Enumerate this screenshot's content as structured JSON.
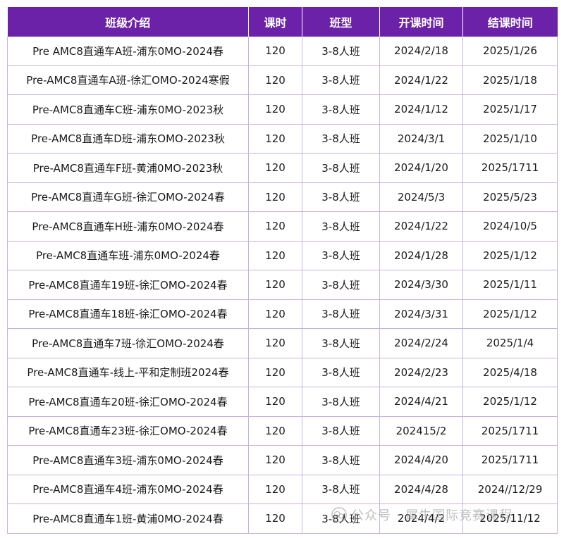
{
  "table": {
    "headers": [
      "班级介绍",
      "课时",
      "班型",
      "开课时间",
      "结课时间"
    ],
    "rows": [
      [
        "Pre AMC8直通车A班-浦东0MO-2024春",
        "120",
        "3-8人班",
        "2024/2/18",
        "2025/1/26"
      ],
      [
        "Pre-AMC8直通车A班-徐汇OMO-2024寒假",
        "120",
        "3-8人班",
        "2024/1/22",
        "2025/1/18"
      ],
      [
        "Pre-AMC8直通车C班-浦东0MO-2023秋",
        "120",
        "3-8人班",
        "2024/1/12",
        "2025/1/17"
      ],
      [
        "Pre-AMC8直通车D班-浦东OMO-2023秋",
        "120",
        "3-8人班",
        "2024/3/1",
        "2025/1/10"
      ],
      [
        "Pre-AMC8直通车F班-黄浦0MO-2023秋",
        "120",
        "3-8人班",
        "2024/1/20",
        "2025/1711"
      ],
      [
        "Pre-AMC8直通车G班-徐汇OMO-2024春",
        "120",
        "3-8人班",
        "2024/5/3",
        "2025/5/23"
      ],
      [
        "Pre-AMC8直通车H班-浦东0MO-2024春",
        "120",
        "3-8人班",
        "2024/1/22",
        "2024/10/5"
      ],
      [
        "Pre-AMC8直通车班-浦东0MO-2024春",
        "120",
        "3-8人班",
        "2024/1/28",
        "2025/1/12"
      ],
      [
        "Pre-AMC8直通车19班-徐汇OMO-2024春",
        "120",
        "3-8人班",
        "2024/3/30",
        "2025/1/11"
      ],
      [
        "Pre-AMC8直通车18班-徐汇OMO-2024春",
        "120",
        "3-8人班",
        "2024/3/31",
        "2025/1/12"
      ],
      [
        "Pre-AMC8直通车7班-徐汇OMO-2024春",
        "120",
        "3-8人班",
        "2024/2/24",
        "2025/1/4"
      ],
      [
        "Pre-AMC8直通车-线上-平和定制班2024春",
        "120",
        "3-8人班",
        "2024/2/23",
        "2025/4/18"
      ],
      [
        "Pre-AMC8直通车20班-徐汇OMO-2024春",
        "120",
        "3-8人班",
        "2024/4/21",
        "2025/1/12"
      ],
      [
        "Pre-AMC8直通车23班-徐汇OMO-2024春",
        "120",
        "3-8人班",
        "202415/2",
        "2025/1711"
      ],
      [
        "Pre-AMC8直通车3班-浦东0MO-2024春",
        "120",
        "3-8人班",
        "2024/4/20",
        "2025/1711"
      ],
      [
        "Pre-AMC8直通车4班-浦东0MO-2024春",
        "120",
        "3-8人班",
        "2024/4/28",
        "2024//12/29"
      ],
      [
        "Pre-AMC8直通车1班-黄浦0MO-2024春",
        "120",
        "3-8人班",
        "2024/4/2",
        "2025/11/12"
      ]
    ]
  },
  "watermark": {
    "text": "公众号 · 犀牛国际竞赛课程",
    "icon": "wechat-icon"
  },
  "colors": {
    "header_bg": "#6b22a8",
    "header_text": "#ffffff",
    "border": "#c8b2dc"
  }
}
